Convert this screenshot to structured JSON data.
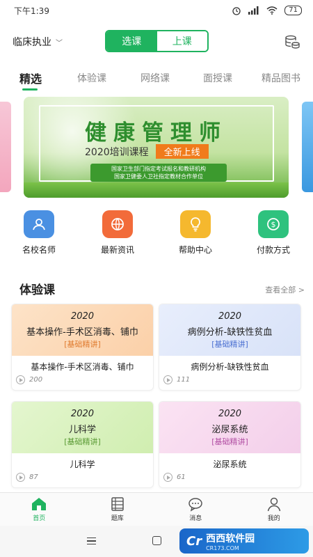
{
  "status_bar": {
    "time": "下午1:39",
    "battery": "71"
  },
  "header": {
    "exam_selector": "临床执业",
    "mode_toggle": [
      {
        "label": "选课",
        "active": true
      },
      {
        "label": "上课",
        "active": false
      }
    ],
    "accent_color": "#1fb35f"
  },
  "tabs": [
    {
      "label": "精选",
      "active": true
    },
    {
      "label": "体验课",
      "active": false
    },
    {
      "label": "网络课",
      "active": false
    },
    {
      "label": "面授课",
      "active": false
    },
    {
      "label": "精品图书",
      "active": false
    }
  ],
  "banner": {
    "headline": "健康管理师",
    "course": "2020培训课程",
    "badge": "全新上线",
    "note_line1": "国家卫生部门指定考试报名和教研机构",
    "note_line2": "国家卫健委人卫社指定教材合作单位"
  },
  "quick_actions": [
    {
      "label": "名校名师",
      "icon": "teacher-icon",
      "color": "#4a90e2"
    },
    {
      "label": "最新资讯",
      "icon": "globe-icon",
      "color": "#f26b3a"
    },
    {
      "label": "帮助中心",
      "icon": "lightbulb-icon",
      "color": "#f5b82e"
    },
    {
      "label": "付款方式",
      "icon": "payment-icon",
      "color": "#2ec27e"
    }
  ],
  "section": {
    "title": "体验课",
    "more": "查看全部 >"
  },
  "courses": [
    {
      "year": "2020",
      "cover_title": "基本操作-手术区消毒、铺巾",
      "tag": "[基础精讲]",
      "name": "基本操作-手术区消毒、铺巾",
      "views": "200",
      "theme": "orange"
    },
    {
      "year": "2020",
      "cover_title": "病例分析-缺铁性贫血",
      "tag": "[基础精讲]",
      "name": "病例分析-缺铁性贫血",
      "views": "111",
      "theme": "blue"
    },
    {
      "year": "2020",
      "cover_title": "儿科学",
      "tag": "[基础精讲]",
      "name": "儿科学",
      "views": "87",
      "theme": "green"
    },
    {
      "year": "2020",
      "cover_title": "泌尿系统",
      "tag": "[基础精讲]",
      "name": "泌尿系统",
      "views": "61",
      "theme": "pink"
    }
  ],
  "bottom_nav": [
    {
      "label": "首页",
      "icon": "home-icon",
      "active": true
    },
    {
      "label": "题库",
      "icon": "question-bank-icon",
      "active": false
    },
    {
      "label": "消息",
      "icon": "message-icon",
      "active": false
    },
    {
      "label": "我的",
      "icon": "profile-icon",
      "active": false
    }
  ],
  "watermark": {
    "logo": "Cr",
    "main": "西西软件园",
    "sub": "CR173.COM"
  }
}
